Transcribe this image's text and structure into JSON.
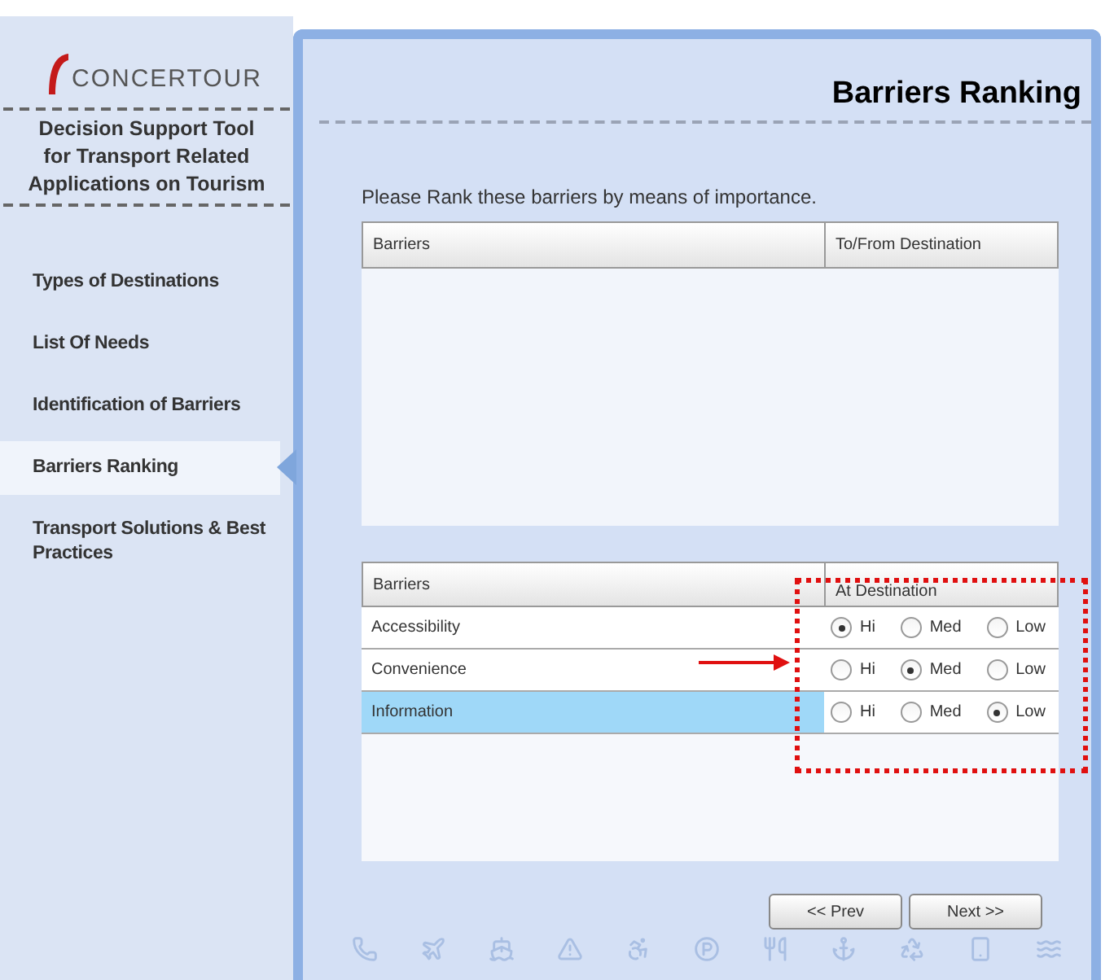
{
  "sidebar": {
    "logo": "CONCERTOUR",
    "subtitle": "Decision Support Tool for Transport Related Applications on Tourism",
    "items": [
      {
        "label": "Types of Destinations",
        "selected": false
      },
      {
        "label": "List Of Needs",
        "selected": false
      },
      {
        "label": "Identification of Barriers",
        "selected": false
      },
      {
        "label": "Barriers Ranking",
        "selected": true
      },
      {
        "label": "Transport Solutions & Best Practices",
        "selected": false
      }
    ]
  },
  "page": {
    "title": "Barriers Ranking",
    "instruction": "Please Rank these barriers by means of importance."
  },
  "table_1": {
    "columns": [
      "Barriers",
      "To/From Destination"
    ]
  },
  "table_2": {
    "columns": [
      "Barriers",
      "At Destination"
    ],
    "rows": [
      {
        "label": "Accessibility",
        "selected": false,
        "options": [
          {
            "label": "Hi",
            "selected": true
          },
          {
            "label": "Med",
            "selected": false
          },
          {
            "label": "Low",
            "selected": false
          }
        ]
      },
      {
        "label": "Convenience",
        "selected": false,
        "options": [
          {
            "label": "Hi",
            "selected": false
          },
          {
            "label": "Med",
            "selected": true
          },
          {
            "label": "Low",
            "selected": false
          }
        ]
      },
      {
        "label": "Information",
        "selected": true,
        "options": [
          {
            "label": "Hi",
            "selected": false
          },
          {
            "label": "Med",
            "selected": false
          },
          {
            "label": "Low",
            "selected": true
          }
        ]
      }
    ]
  },
  "buttons": [
    "<< Prev",
    "Next >>"
  ]
}
